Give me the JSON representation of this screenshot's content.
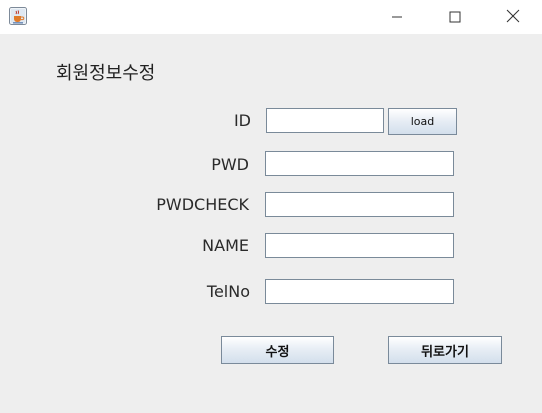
{
  "window": {
    "icon": "java-coffee-icon",
    "controls": [
      "minimize-icon",
      "maximize-icon",
      "close-icon"
    ]
  },
  "form": {
    "title": "회원정보수정",
    "fields": {
      "id": {
        "label": "ID",
        "value": ""
      },
      "pwd": {
        "label": "PWD",
        "value": ""
      },
      "pwdcheck": {
        "label": "PWDCHECK",
        "value": ""
      },
      "name": {
        "label": "NAME",
        "value": ""
      },
      "telno": {
        "label": "TelNo",
        "value": ""
      }
    },
    "load_label": "load",
    "submit_label": "수정",
    "back_label": "뒤로가기"
  }
}
